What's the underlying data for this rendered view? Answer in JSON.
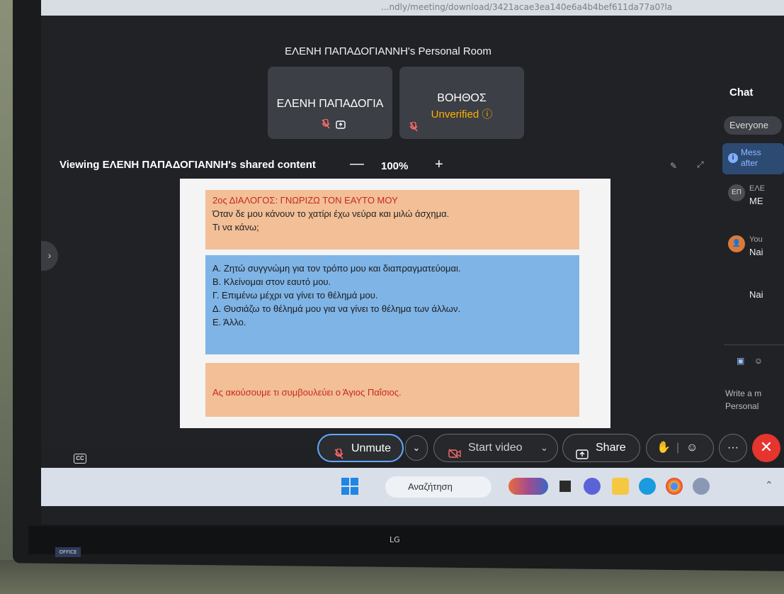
{
  "browser": {
    "url_fragment": "...ndly/meeting/download/3421acae3ea140e6a4b4bef611da77a0?la"
  },
  "meeting": {
    "room_title": "ΕΛΕΝΗ ΠΑΠΑΔΟΓΙΑΝΝΗ's Personal Room",
    "participants": [
      {
        "name": "ΕΛΕΝΗ ΠΑΠΑΔΟΓΙΑ",
        "status": ""
      },
      {
        "name": "ΒΟΗΘΟΣ",
        "status": "Unverified"
      }
    ],
    "viewing_label": "Viewing ΕΛΕΝΗ ΠΑΠΑΔΟΓΙΑΝΝΗ's shared content",
    "zoom_minus": "—",
    "zoom_value": "100%",
    "zoom_plus": "+"
  },
  "slide": {
    "heading_num": "2ος",
    "heading": "ΔΙΑΛΟΓΟΣ: ΓΝΩΡΙΖΩ ΤΟΝ ΕΑΥΤΟ ΜΟΥ",
    "line1": "Όταν δε μου κάνουν το χατίρι έχω νεύρα και μιλώ άσχημα.",
    "line2": "Τι να κάνω;",
    "options": [
      "Α. Ζητώ συγγνώμη για τον τρόπο μου και διαπραγματεύομαι.",
      "Β. Κλείνομαι στον εαυτό μου.",
      "Γ. Επιμένω μέχρι να γίνει το θέλημά μου.",
      "Δ. Θυσιάζω το θέλημά μου για να γίνει το θέλημα των άλλων.",
      "Ε. Άλλο."
    ],
    "footer": "Ας ακούσουμε τι συμβουλεύει ο Άγιος Παΐσιος."
  },
  "chat": {
    "title": "Chat",
    "recipient": "Everyone",
    "notice": [
      "Mess",
      "after"
    ],
    "messages": [
      {
        "initials": "ΕΠ",
        "sender": "ΕΛΕ",
        "text": "ΜΕ"
      },
      {
        "initials": "",
        "sender": "You",
        "text": "Nai"
      }
    ],
    "extra_line": "Nai",
    "compose_line1": "Write a m",
    "compose_line2": "Personal"
  },
  "controls": {
    "unmute": "Unmute",
    "start_video": "Start video",
    "share": "Share",
    "more": "···",
    "cc": "CC"
  },
  "taskbar": {
    "search_placeholder": "Αναζήτηση"
  },
  "device": {
    "brand": "LG",
    "sticker": "OFFICE"
  },
  "colors": {
    "accent_blue": "#62a8ff",
    "leave_red": "#e5352e",
    "unverified_orange": "#ffb000",
    "slide_orange": "#f2bf97",
    "slide_blue": "#7fb4e6"
  }
}
